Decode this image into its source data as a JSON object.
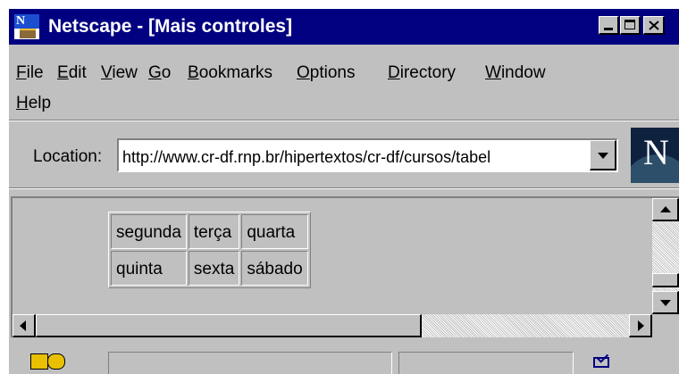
{
  "window": {
    "title": "Netscape - [Mais controles]"
  },
  "menu": {
    "items": [
      {
        "label": "File",
        "mnemonic_index": 0
      },
      {
        "label": "Edit",
        "mnemonic_index": 0
      },
      {
        "label": "View",
        "mnemonic_index": 0
      },
      {
        "label": "Go",
        "mnemonic_index": 0
      },
      {
        "label": "Bookmarks",
        "mnemonic_index": 0
      },
      {
        "label": "Options",
        "mnemonic_index": 0
      },
      {
        "label": "Directory",
        "mnemonic_index": 0
      },
      {
        "label": "Window",
        "mnemonic_index": 0
      },
      {
        "label": "Help",
        "mnemonic_index": 0
      }
    ]
  },
  "location": {
    "label": "Location:",
    "url": "http://www.cr-df.rnp.br/hipertextos/cr-df/cursos/tabel"
  },
  "table": {
    "rows": [
      [
        "segunda",
        "terça",
        "quarta"
      ],
      [
        "quinta",
        "sexta",
        "sábado"
      ]
    ]
  },
  "icons": {
    "app": "netscape-app-icon",
    "logo": "netscape-n-logo",
    "security": "security-key-icon",
    "mail": "mail-envelope-icon"
  },
  "colors": {
    "titlebar": "#000080",
    "chrome": "#c0c0c0"
  }
}
